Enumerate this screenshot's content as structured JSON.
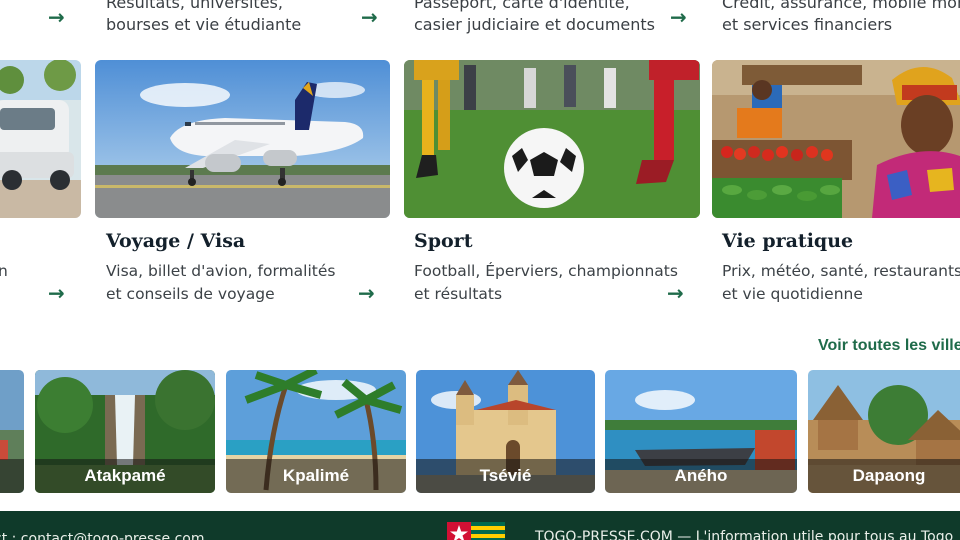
{
  "top_categories": [
    {
      "line1": "Résultats, universités,",
      "line2": "bourses et vie étudiante"
    },
    {
      "line1": "Passeport, carte d'identité,",
      "line2": "casier judiciaire et documents"
    },
    {
      "line1": "Crédit, assurance, mobile money",
      "line2": "et services financiers"
    }
  ],
  "cards": [
    {
      "title": "",
      "line1": "",
      "line2": "n"
    },
    {
      "title": "Voyage / Visa",
      "line1": "Visa, billet d'avion, formalités",
      "line2": "et conseils de voyage"
    },
    {
      "title": "Sport",
      "line1": "Football, Éperviers, championnats",
      "line2": "et résultats"
    },
    {
      "title": "Vie pratique",
      "line1": "Prix, météo, santé, restaurants",
      "line2": "et vie quotidienne"
    }
  ],
  "arrow_glyph": "→",
  "see_all_label": "Voir toutes les villes",
  "cities": [
    {
      "name": ""
    },
    {
      "name": "Atakpamé"
    },
    {
      "name": "Kpalimé"
    },
    {
      "name": "Tsévié"
    },
    {
      "name": "Aného"
    },
    {
      "name": "Dapaong"
    }
  ],
  "footer": {
    "contact": "ct : contact@togo-presse.com",
    "tagline": "TOGO-PRESSE.COM — L'information utile pour tous au Togo"
  },
  "colors": {
    "accent_green": "#1f6b4a",
    "footer_bg": "#0f3a2a"
  }
}
